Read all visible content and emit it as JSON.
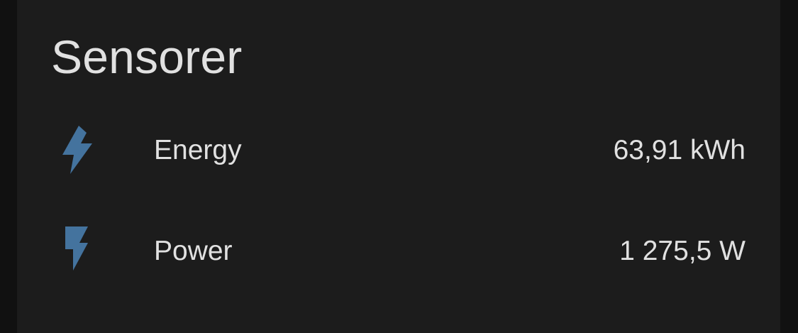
{
  "card": {
    "title": "Sensorer",
    "entities": [
      {
        "name": "Energy",
        "state": "63,91 kWh",
        "icon": "lightning-bolt-icon"
      },
      {
        "name": "Power",
        "state": "1 275,5 W",
        "icon": "flash-icon"
      }
    ]
  },
  "colors": {
    "background": "#111111",
    "card_background": "#1c1c1c",
    "text": "#e1e1e1",
    "icon": "#44739e"
  }
}
